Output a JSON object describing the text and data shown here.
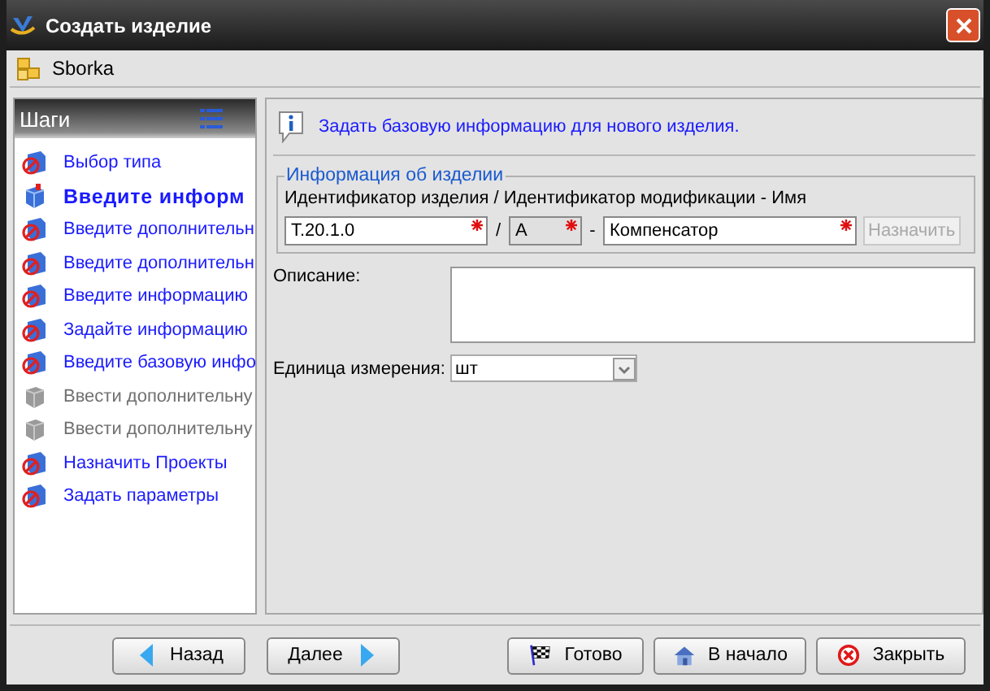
{
  "window": {
    "title": "Создать изделие"
  },
  "toolbar": {
    "label": "Sborka"
  },
  "steps_panel": {
    "title": "Шаги",
    "items": [
      {
        "label": "Выбор типа",
        "kind": "done"
      },
      {
        "label": "Введите информ",
        "kind": "current"
      },
      {
        "label": "Введите дополнительн",
        "kind": "done"
      },
      {
        "label": "Введите дополнительн",
        "kind": "done"
      },
      {
        "label": "Введите информацию",
        "kind": "done"
      },
      {
        "label": "Задайте информацию",
        "kind": "done"
      },
      {
        "label": "Введите базовую инфо",
        "kind": "done"
      },
      {
        "label": "Ввести дополнительну",
        "kind": "disabled"
      },
      {
        "label": "Ввести дополнительну",
        "kind": "disabled"
      },
      {
        "label": "Назначить Проекты",
        "kind": "done"
      },
      {
        "label": "Задать параметры",
        "kind": "done"
      }
    ]
  },
  "hint": "Задать базовую информацию для нового изделия.",
  "group": {
    "title": "Информация об изделии",
    "caption": "Идентификатор изделия / Идентификатор модификации - Имя",
    "fields": [
      {
        "value": "T.20.1.0",
        "required": true,
        "disabled": false
      },
      {
        "separator": "/",
        "value": "A",
        "required": true,
        "disabled": true
      },
      {
        "separator": "-",
        "value": "Компенсатор",
        "required": true,
        "disabled": false
      }
    ],
    "assign_button": {
      "label": "Назначить",
      "disabled": true
    }
  },
  "description": {
    "label": "Описание:"
  },
  "unit": {
    "label": "Единица измерения:",
    "value": "шт"
  },
  "buttons": [
    {
      "label": "Назад",
      "kind": "back"
    },
    {
      "label": "Далее",
      "kind": "next"
    },
    {
      "label": "Готово",
      "kind": "finish"
    },
    {
      "label": "В начало",
      "kind": "start"
    },
    {
      "label": "Закрыть",
      "kind": "close"
    }
  ]
}
